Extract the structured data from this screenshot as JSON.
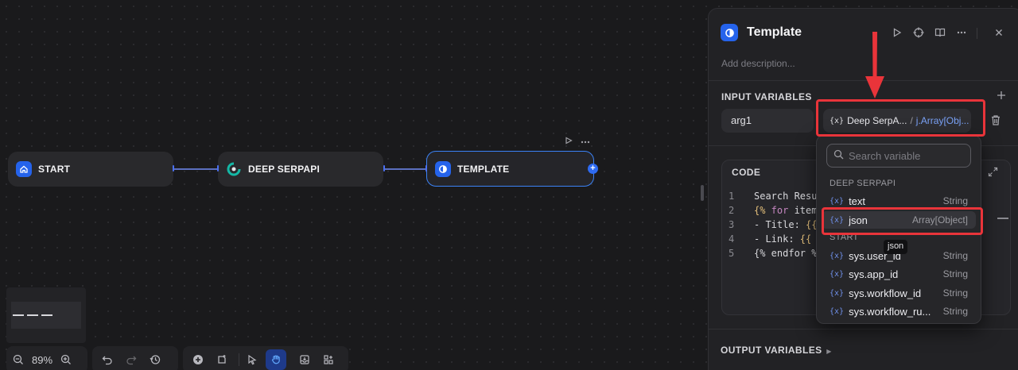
{
  "canvas": {
    "nodes": [
      {
        "label": "START",
        "icon": "home-icon",
        "color": "#2563eb"
      },
      {
        "label": "DEEP SERPAPI",
        "icon": "serpapi-logo-icon",
        "color": "#0d9488"
      },
      {
        "label": "TEMPLATE",
        "icon": "template-icon",
        "color": "#2563eb"
      }
    ],
    "zoom": "89%"
  },
  "panel": {
    "title": "Template",
    "description_placeholder": "Add description...",
    "input_variables_label": "INPUT VARIABLES",
    "variable": {
      "name": "arg1",
      "ref_node": "Deep SerpA...",
      "ref_separator": "/",
      "ref_var": "j.Array[Obj..."
    },
    "code_label": "CODE",
    "code_lines": [
      {
        "n": "1",
        "text": "Search Resul"
      },
      {
        "n": "2",
        "kw_open": "{%",
        "kw": " for",
        "text": " item"
      },
      {
        "n": "3",
        "text": "- Title: ",
        "br": "{{"
      },
      {
        "n": "4",
        "text": "- Link: ",
        "br": "{{"
      },
      {
        "n": "5",
        "text": "{% endfor %}"
      }
    ],
    "output_variables_label": "OUTPUT VARIABLES"
  },
  "dropdown": {
    "search_placeholder": "Search variable",
    "groups": [
      {
        "label": "DEEP SERPAPI",
        "items": [
          {
            "name": "text",
            "type": "String"
          },
          {
            "name": "json",
            "type": "Array[Object]"
          }
        ]
      },
      {
        "label": "START",
        "items": [
          {
            "name": "sys.user_id",
            "type": "String"
          },
          {
            "name": "sys.app_id",
            "type": "String"
          },
          {
            "name": "sys.workflow_id",
            "type": "String"
          },
          {
            "name": "sys.workflow_ru...",
            "type": "String"
          }
        ]
      }
    ],
    "tooltip": "json"
  },
  "colors": {
    "accent": "#2563eb",
    "annotation_red": "#e9343a"
  }
}
